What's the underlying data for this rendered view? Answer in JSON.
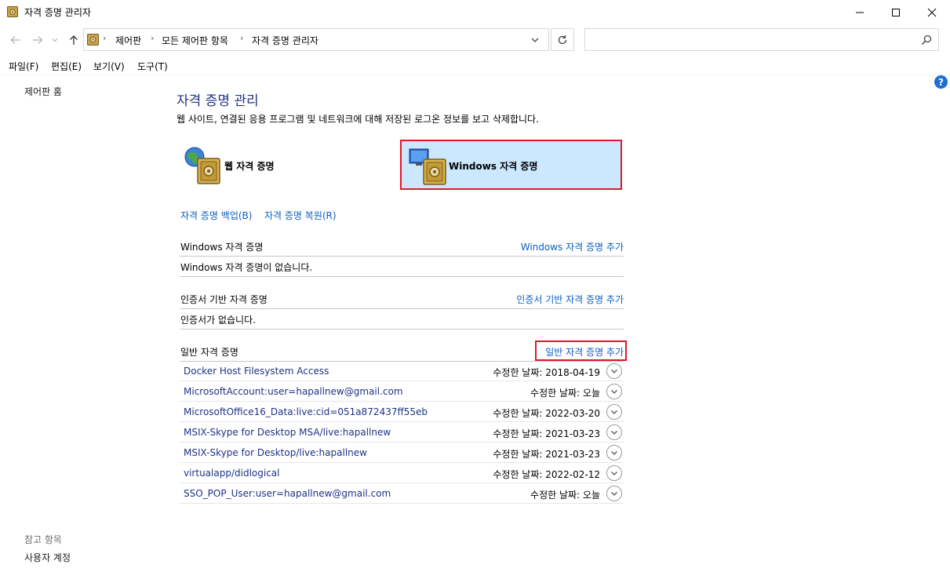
{
  "window": {
    "title": "자격 증명 관리자"
  },
  "address": {
    "crumbs": [
      "제어판",
      "모든 제어판 항목",
      "자격 증명 관리자"
    ],
    "search_placeholder": ""
  },
  "menu": [
    "파일(F)",
    "편집(E)",
    "보기(V)",
    "도구(T)"
  ],
  "left_nav": {
    "home": "제어판 홈",
    "see_also_label": "참고 항목",
    "user_accounts": "사용자 계정"
  },
  "main": {
    "heading": "자격 증명 관리",
    "description": "웹 사이트, 연결된 응용 프로그램 및 네트워크에 대해 저장된 로그온 정보를 보고 삭제합니다.",
    "tiles": {
      "web": "웹 자격 증명",
      "windows": "Windows 자격 증명"
    },
    "backup_link": "자격 증명 백업(B)",
    "restore_link": "자격 증명 복원(R)",
    "windows_section": {
      "title": "Windows 자격 증명",
      "add": "Windows 자격 증명 추가",
      "empty": "Windows 자격 증명이 없습니다."
    },
    "cert_section": {
      "title": "인증서 기반 자격 증명",
      "add": "인증서 기반 자격 증명 추가",
      "empty": "인증서가 없습니다."
    },
    "generic_section": {
      "title": "일반 자격 증명",
      "add": "일반 자격 증명 추가",
      "items": [
        {
          "name": "Docker Host Filesystem Access",
          "date": "수정한 날짜:  2018-04-19"
        },
        {
          "name": "MicrosoftAccount:user=hapallnew@gmail.com",
          "date": "수정한 날짜:  오늘"
        },
        {
          "name": "MicrosoftOffice16_Data:live:cid=051a872437ff55eb",
          "date": "수정한 날짜:  2022-03-20"
        },
        {
          "name": "MSIX-Skype for Desktop MSA/live:hapallnew",
          "date": "수정한 날짜:  2021-03-23"
        },
        {
          "name": "MSIX-Skype for Desktop/live:hapallnew",
          "date": "수정한 날짜:  2021-03-23"
        },
        {
          "name": "virtualapp/didlogical",
          "date": "수정한 날짜:  2022-02-12"
        },
        {
          "name": "SSO_POP_User:user=hapallnew@gmail.com",
          "date": "수정한 날짜:  오늘"
        }
      ]
    }
  },
  "colors": {
    "link": "#0a5fc2",
    "heading": "#1e3287",
    "selected_tile": "#cce8ff",
    "highlight_border": "#e0192a"
  }
}
